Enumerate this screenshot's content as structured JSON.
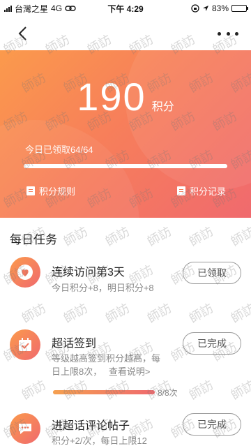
{
  "status_bar": {
    "carrier": "台灣之星",
    "network": "4G",
    "time": "下午 4:29",
    "battery": "83%",
    "battery_level": 0.83
  },
  "nav": {
    "back_icon": "chevron-left-icon",
    "more_icon": "more-dots-icon"
  },
  "points": {
    "value": "190",
    "unit": "积分",
    "daily_label": "今日已领取64/64",
    "daily_progress": 1.0,
    "rules_label": "积分规则",
    "records_label": "积分记录"
  },
  "daily_tasks": {
    "title": "每日任务",
    "items": [
      {
        "title": "连续访问第3天",
        "desc": "今日积分+8，明日积分+8",
        "button": "已领取",
        "icon": "heart-icon"
      },
      {
        "title": "超话签到",
        "desc_line1": "等级越高签到积分越高，每",
        "desc_line2": "日上限8次，",
        "desc_link": "查看说明>",
        "button": "已完成",
        "icon": "calendar-check-icon",
        "progress_label": "8/8次",
        "progress": 1.0
      },
      {
        "title": "进超话评论帖子",
        "desc": "积分+2/次，每日上限12",
        "button": "已完成",
        "icon": "chat-bubble-icon"
      }
    ]
  },
  "watermark": "師訪",
  "colors": {
    "gradient_start": "#fb9a4c",
    "gradient_end": "#f06a6e",
    "button_border": "#9a9a9a"
  }
}
